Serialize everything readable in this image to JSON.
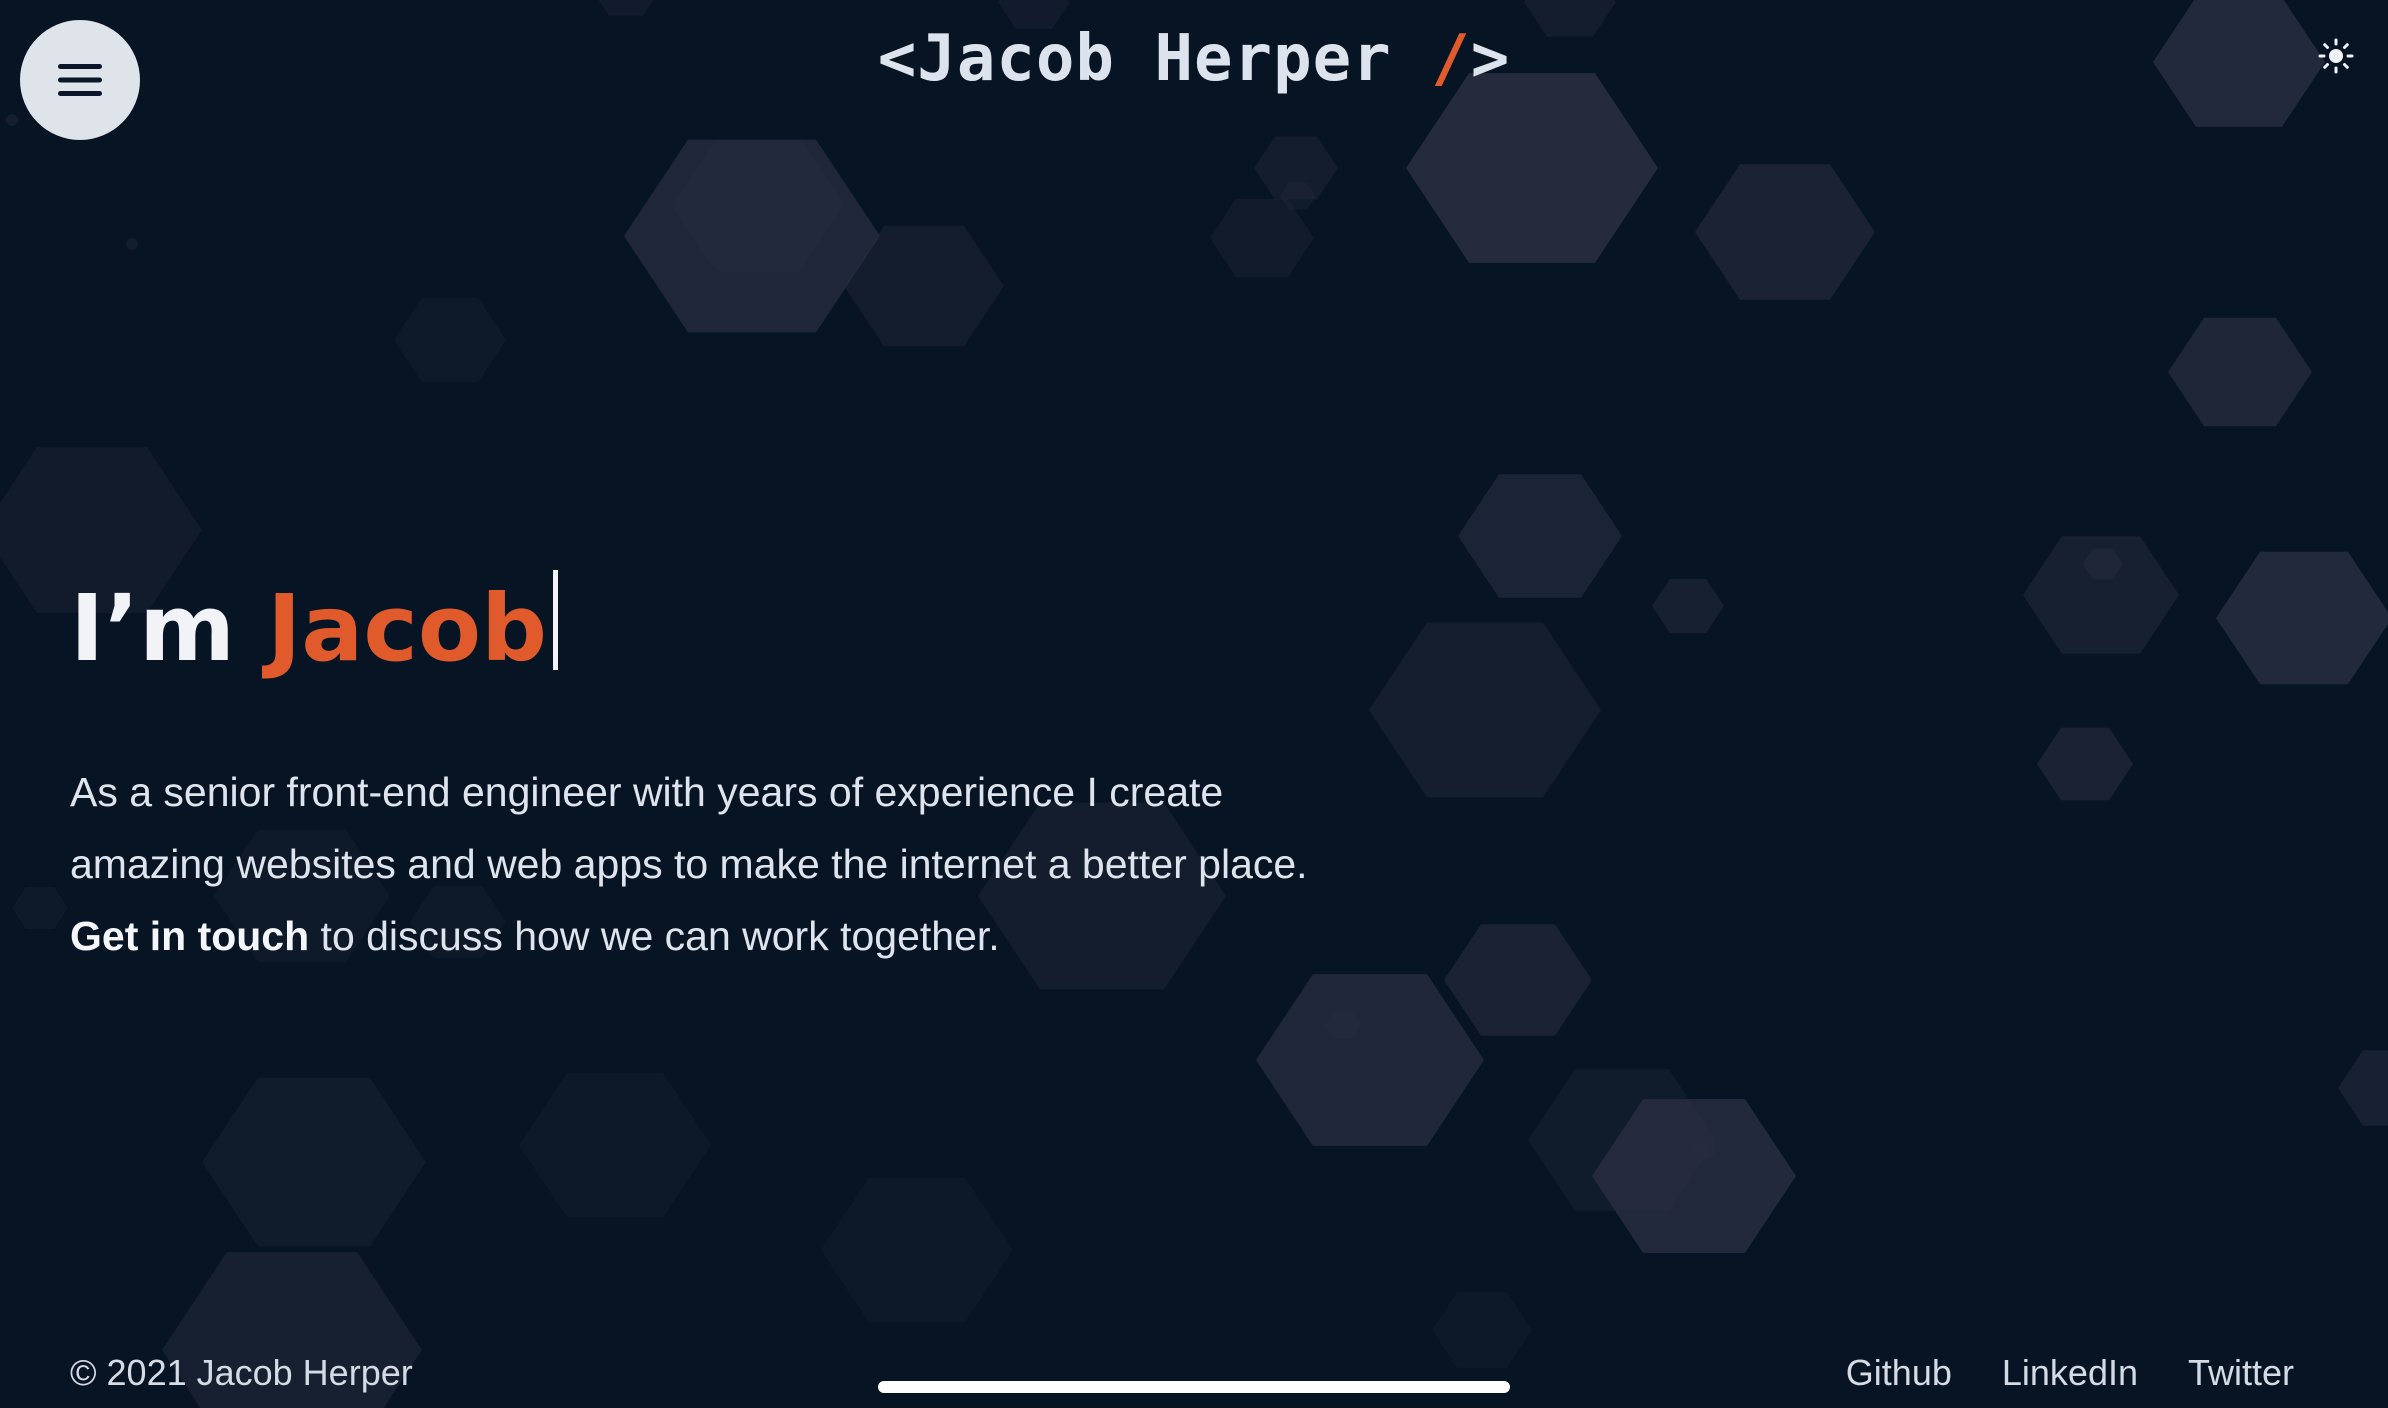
{
  "header": {
    "logo_open": "<Jacob",
    "logo_last": " Herper ",
    "logo_slash": "/",
    "logo_close": ">",
    "menu_icon": "hamburger-icon",
    "theme_icon": "sun-icon"
  },
  "hero": {
    "greeting": "I’m ",
    "name": "Jacob",
    "text_before": "As a senior front-end engineer with years of experience I create amazing websites and web apps to make the internet a better place. ",
    "cta": "Get in touch",
    "text_after": " to discuss how we can work together."
  },
  "footer": {
    "copyright": "© 2021 Jacob Herper",
    "links": [
      "Github",
      "LinkedIn",
      "Twitter"
    ]
  },
  "colors": {
    "background": "#071424",
    "accent": "#e05a2b",
    "text": "#dfe4ec",
    "hexagon": "#2a2e42"
  }
}
